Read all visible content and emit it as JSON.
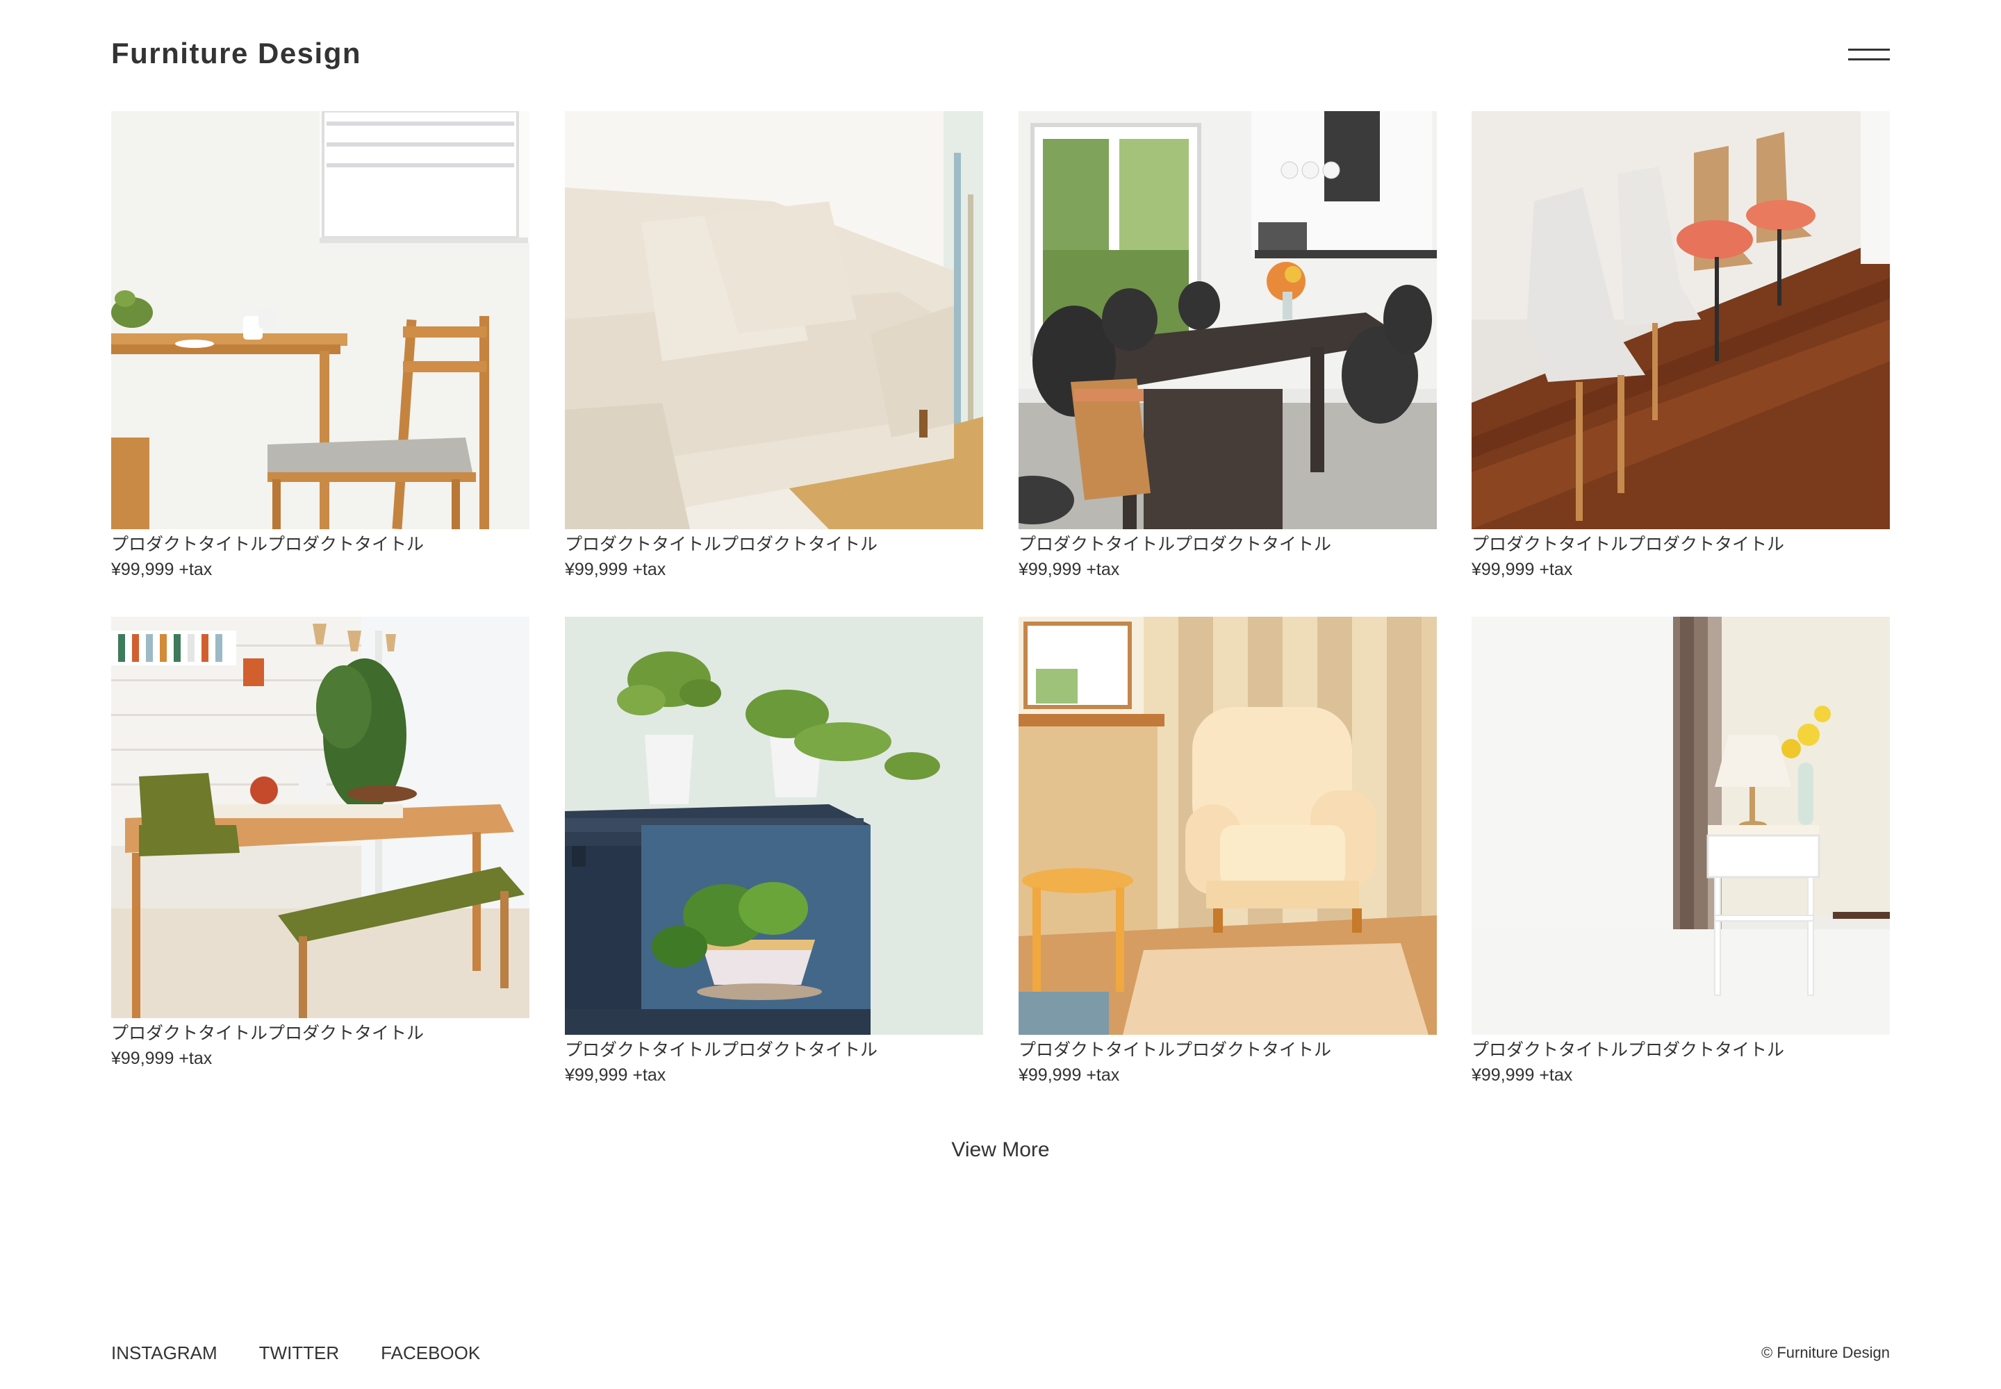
{
  "header": {
    "logo": "Furniture Design",
    "menu_icon": "hamburger-menu-icon"
  },
  "products": [
    {
      "title": "プロダクトタイトルプロダクトタイトル",
      "price": "¥99,999 +tax",
      "image": "dining-table-and-chair"
    },
    {
      "title": "プロダクトタイトルプロダクトタイトル",
      "price": "¥99,999 +tax",
      "image": "beige-sofa"
    },
    {
      "title": "プロダクトタイトルプロダクトタイトル",
      "price": "¥99,999 +tax",
      "image": "dining-room-with-black-chairs"
    },
    {
      "title": "プロダクトタイトルプロダクトタイトル",
      "price": "¥99,999 +tax",
      "image": "row-of-chairs"
    },
    {
      "title": "プロダクトタイトルプロダクトタイトル",
      "price": "¥99,999 +tax",
      "image": "wooden-dining-set-green-cushions"
    },
    {
      "title": "プロダクトタイトルプロダクトタイトル",
      "price": "¥99,999 +tax",
      "image": "shelf-with-plants"
    },
    {
      "title": "プロダクトタイトルプロダクトタイトル",
      "price": "¥99,999 +tax",
      "image": "armchair-wooden-room"
    },
    {
      "title": "プロダクトタイトルプロダクトタイトル",
      "price": "¥99,999 +tax",
      "image": "bedside-table-with-lamp"
    }
  ],
  "view_more": "View More",
  "footer": {
    "social": [
      "INSTAGRAM",
      "TWITTER",
      "FACEBOOK"
    ],
    "copyright": "© Furniture Design"
  }
}
